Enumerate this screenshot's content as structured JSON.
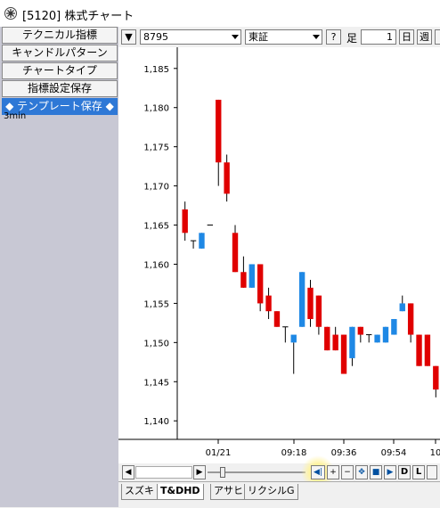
{
  "window": {
    "title": "[5120] 株式チャート"
  },
  "left_panel": {
    "buttons": [
      "テクニカル指標",
      "キャンドルパターン",
      "チャートタイプ",
      "指標設定保存"
    ],
    "template_button": "◆ テンプレート保存 ◆",
    "interval": "3min"
  },
  "toolbar": {
    "menu": "▼",
    "code": "8795",
    "market": "東証",
    "help": "?",
    "ashi": "足",
    "field": "1",
    "day": "日",
    "week": "週"
  },
  "chart_data": {
    "type": "candlestick",
    "x_tick_labels": [
      "01/21",
      "09:18",
      "09:36",
      "09:54",
      "10"
    ],
    "y_tick_labels": [
      "1,185",
      "1,180",
      "1,175",
      "1,170",
      "1,165",
      "1,160",
      "1,155",
      "1,150",
      "1,145",
      "1,140"
    ],
    "ylim": [
      1139,
      1186
    ],
    "up_color": "#1e88e5",
    "down_color": "#e00000",
    "candles": [
      {
        "o": 1167,
        "h": 1168,
        "l": 1163,
        "c": 1164
      },
      {
        "o": 1163,
        "h": 1163,
        "l": 1162,
        "c": 1163
      },
      {
        "o": 1162,
        "h": 1164,
        "l": 1162,
        "c": 1164
      },
      {
        "o": 1165,
        "h": 1165,
        "l": 1165,
        "c": 1165
      },
      {
        "o": 1181,
        "h": 1181,
        "l": 1170,
        "c": 1173
      },
      {
        "o": 1173,
        "h": 1174,
        "l": 1168,
        "c": 1169
      },
      {
        "o": 1164,
        "h": 1165,
        "l": 1159,
        "c": 1159
      },
      {
        "o": 1159,
        "h": 1161,
        "l": 1157,
        "c": 1157
      },
      {
        "o": 1157,
        "h": 1160,
        "l": 1157,
        "c": 1160
      },
      {
        "o": 1160,
        "h": 1160,
        "l": 1154,
        "c": 1155
      },
      {
        "o": 1156,
        "h": 1157,
        "l": 1153,
        "c": 1154
      },
      {
        "o": 1154,
        "h": 1154,
        "l": 1152,
        "c": 1152
      },
      {
        "o": 1152,
        "h": 1152,
        "l": 1150,
        "c": 1152
      },
      {
        "o": 1150,
        "h": 1150,
        "l": 1146,
        "c": 1151
      },
      {
        "o": 1152,
        "h": 1159,
        "l": 1152,
        "c": 1159
      },
      {
        "o": 1157,
        "h": 1158,
        "l": 1152,
        "c": 1153
      },
      {
        "o": 1156,
        "h": 1156,
        "l": 1151,
        "c": 1152
      },
      {
        "o": 1152,
        "h": 1152,
        "l": 1149,
        "c": 1149
      },
      {
        "o": 1151,
        "h": 1152,
        "l": 1149,
        "c": 1149
      },
      {
        "o": 1151,
        "h": 1151,
        "l": 1146,
        "c": 1146
      },
      {
        "o": 1148,
        "h": 1152,
        "l": 1147,
        "c": 1152
      },
      {
        "o": 1152,
        "h": 1152,
        "l": 1150,
        "c": 1151
      },
      {
        "o": 1151,
        "h": 1151,
        "l": 1150,
        "c": 1151
      },
      {
        "o": 1150,
        "h": 1151,
        "l": 1150,
        "c": 1151
      },
      {
        "o": 1150,
        "h": 1152,
        "l": 1150,
        "c": 1152
      },
      {
        "o": 1151,
        "h": 1153,
        "l": 1151,
        "c": 1153
      },
      {
        "o": 1154,
        "h": 1156,
        "l": 1154,
        "c": 1155
      },
      {
        "o": 1155,
        "h": 1155,
        "l": 1150,
        "c": 1151
      },
      {
        "o": 1151,
        "h": 1151,
        "l": 1147,
        "c": 1147
      },
      {
        "o": 1151,
        "h": 1151,
        "l": 1147,
        "c": 1147
      },
      {
        "o": 1147,
        "h": 1147,
        "l": 1143,
        "c": 1144
      }
    ]
  },
  "nav": {
    "left": "◀",
    "right": "▶",
    "jump_start": "◀|",
    "plus": "+",
    "minus": "−",
    "move": "✥",
    "stop": "■",
    "play": "▶",
    "d": "D",
    "l": "L"
  },
  "tabs": [
    "スズキ",
    "T&DHD",
    "アサヒ",
    "リクシルG"
  ],
  "active_tab": 1
}
